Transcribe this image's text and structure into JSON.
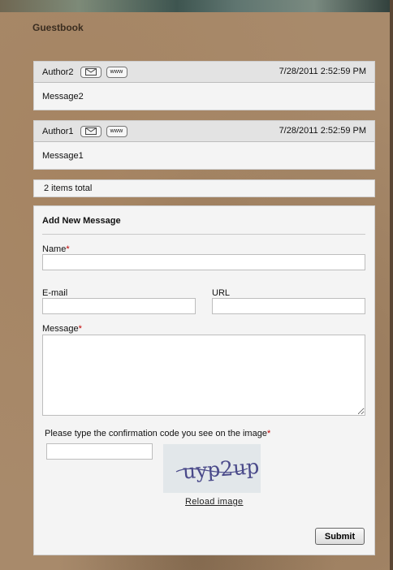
{
  "page": {
    "title": "Guestbook"
  },
  "entries": [
    {
      "author": "Author2",
      "date": "7/28/2011 2:52:59 PM",
      "message": "Message2",
      "www_label": "www"
    },
    {
      "author": "Author1",
      "date": "7/28/2011 2:52:59 PM",
      "message": "Message1",
      "www_label": "www"
    }
  ],
  "total_text": "2 items total",
  "form": {
    "title": "Add New Message",
    "name_label": "Name",
    "email_label": "E-mail",
    "url_label": "URL",
    "message_label": "Message",
    "required_marker": "*",
    "captcha_prompt": "Please type the confirmation code you see on the image",
    "captcha_text": "uyp2up",
    "reload_label": "Reload image",
    "submit_label": "Submit",
    "name_value": "",
    "email_value": "",
    "url_value": "",
    "message_value": "",
    "captcha_value": ""
  },
  "colors": {
    "required": "#c00000",
    "panel": "#f4f4f4",
    "header": "#e3e3e3"
  }
}
